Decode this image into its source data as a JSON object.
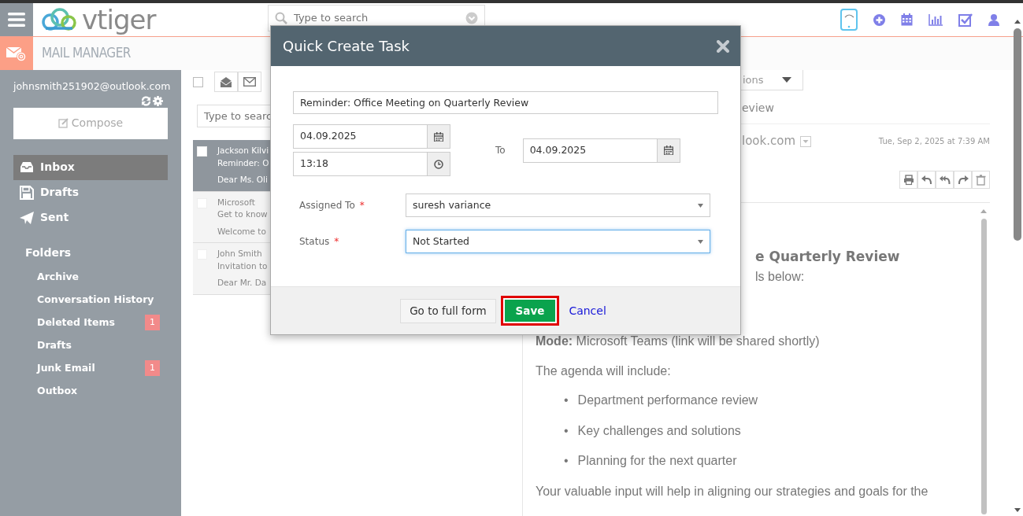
{
  "topbar": {
    "logo": "vtiger",
    "search": {
      "placeholder": "Type to search"
    }
  },
  "module": {
    "title": "MAIL MANAGER"
  },
  "sidebar": {
    "account": "johnsmith251902@outlook.com",
    "compose": "Compose",
    "mailboxes": [
      {
        "label": "Inbox",
        "selected": true
      },
      {
        "label": "Drafts",
        "selected": false
      },
      {
        "label": "Sent",
        "selected": false
      }
    ],
    "folders_heading": "Folders",
    "folders": [
      {
        "label": "Archive"
      },
      {
        "label": "Conversation History"
      },
      {
        "label": "Deleted Items",
        "count": "1"
      },
      {
        "label": "Drafts"
      },
      {
        "label": "Junk Email",
        "count": "1"
      },
      {
        "label": "Outbox"
      }
    ]
  },
  "mail_list": {
    "select_all": {
      "checked": false
    },
    "search": {
      "placeholder": "Type to searc"
    },
    "messages": [
      {
        "sender": "Jackson Kilvi",
        "subject": "Reminder: O",
        "preview": "Dear Ms. Oli",
        "selected": true,
        "checked": false
      },
      {
        "sender": "Microsoft",
        "subject": "Get to know",
        "preview": "Welcome to",
        "selected": false,
        "checked": false
      },
      {
        "sender": "John Smith",
        "subject": "Invitation to",
        "preview": "Dear Mr. Da",
        "selected": false,
        "checked": false
      }
    ]
  },
  "reader": {
    "actions": "ions",
    "subject": "eview",
    "sender": "look.com",
    "date": "Tue, Sep 2, 2025 at 7:39 AM",
    "body": [
      {
        "kind": "heading",
        "text": "e Quarterly Review"
      },
      {
        "kind": "fragment",
        "text": "ls below:"
      },
      {
        "kind": "para",
        "text": "**Mode:** Microsoft Teams (link will be shared shortly)"
      },
      {
        "kind": "para",
        "text": "The agenda will include:"
      },
      {
        "kind": "list",
        "items": [
          {
            "bullet": "•",
            "text": "Department performance review"
          },
          {
            "bullet": "•",
            "text": "Key challenges and solutions"
          },
          {
            "bullet": "•",
            "text": "Planning for the next quarter"
          }
        ]
      },
      {
        "kind": "para",
        "text": "Your valuable input will help in aligning our strategies and goals for the"
      }
    ]
  },
  "modal": {
    "title": "Quick Create Task",
    "subject": "Reminder: Office Meeting on Quarterly Review",
    "start_date": "04.09.2025",
    "start_time": "13:18",
    "to_label": "To",
    "end_date": "04.09.2025",
    "fields": [
      {
        "label": "Assigned To",
        "required_mark": "*",
        "value": "suresh variance",
        "focused": false
      },
      {
        "label": "Status",
        "required_mark": "*",
        "value": "Not Started",
        "focused": true
      }
    ],
    "full_form": "Go to full form",
    "save": "Save",
    "save_highlighted": true,
    "cancel": "Cancel"
  }
}
